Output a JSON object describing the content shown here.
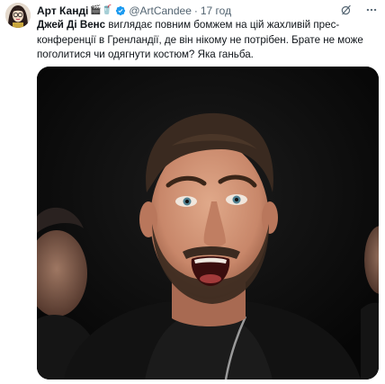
{
  "tweet": {
    "author_name": "Арт Канді",
    "author_emojis": "🎬🥤",
    "handle": "@ArtCandee",
    "separator": "·",
    "time": "17 год",
    "text_bold": "Джей Ді Венс",
    "text_rest": " виглядає повним бомжем на цій жахливій прес-конференції в Гренландії, де він нікому не потрібен. Брате не може поголитися чи одягнути костюм? Яка ганьба.",
    "verified": true
  },
  "icons": {
    "avatar": "avatar",
    "verified": "verified-badge-icon",
    "grok": "grok-icon",
    "more": "more-options-icon"
  },
  "colors": {
    "verified": "#1d9bf0",
    "secondary_text": "#536471",
    "media_bg": "#0c0c0c"
  }
}
